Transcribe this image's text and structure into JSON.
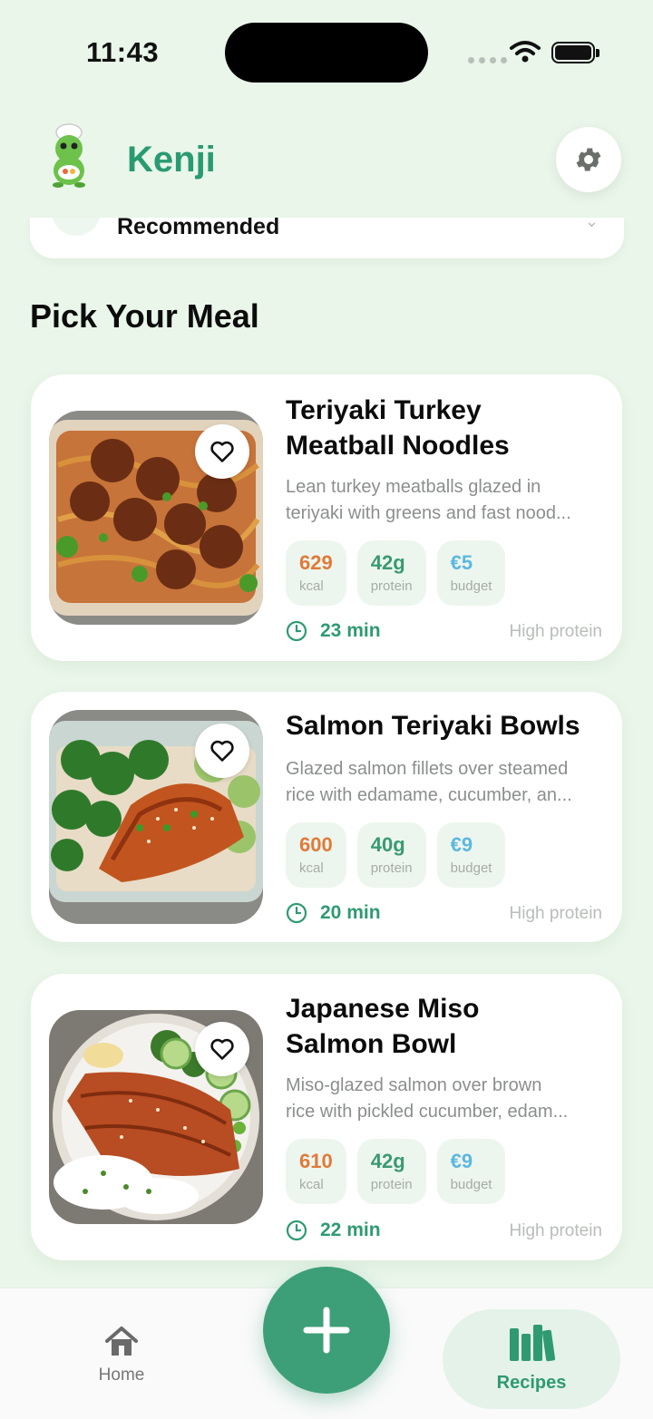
{
  "status_bar": {
    "time": "11:43"
  },
  "header": {
    "title": "Kenji"
  },
  "filter": {
    "label": "Recommended"
  },
  "section": {
    "title": "Pick Your Meal"
  },
  "meals": [
    {
      "title_line1": "Teriyaki Turkey",
      "title_line2": "Meatball Noodles",
      "desc_line1": "Lean turkey meatballs glazed in",
      "desc_line2": "teriyaki with greens and fast nood...",
      "kcal": "629",
      "kcal_label": "kcal",
      "protein": "42g",
      "protein_label": "protein",
      "budget": "€5",
      "budget_label": "budget",
      "time": "23 min",
      "tag": "High protein"
    },
    {
      "title_line1": "Salmon Teriyaki Bowls",
      "title_line2": "",
      "desc_line1": "Glazed salmon fillets over steamed",
      "desc_line2": "rice with edamame, cucumber, an...",
      "kcal": "600",
      "kcal_label": "kcal",
      "protein": "40g",
      "protein_label": "protein",
      "budget": "€9",
      "budget_label": "budget",
      "time": "20 min",
      "tag": "High protein"
    },
    {
      "title_line1": "Japanese Miso",
      "title_line2": "Salmon Bowl",
      "desc_line1": "Miso-glazed salmon over brown",
      "desc_line2": "rice with pickled cucumber, edam...",
      "kcal": "610",
      "kcal_label": "kcal",
      "protein": "42g",
      "protein_label": "protein",
      "budget": "€9",
      "budget_label": "budget",
      "time": "22 min",
      "tag": "High protein"
    }
  ],
  "nav": {
    "home": "Home",
    "recipes": "Recipes"
  },
  "colors": {
    "accent": "#3d9f78",
    "kcal": "#e07a3a",
    "protein": "#3a9a72",
    "budget": "#5cb8df",
    "background": "#e9f6e9"
  }
}
